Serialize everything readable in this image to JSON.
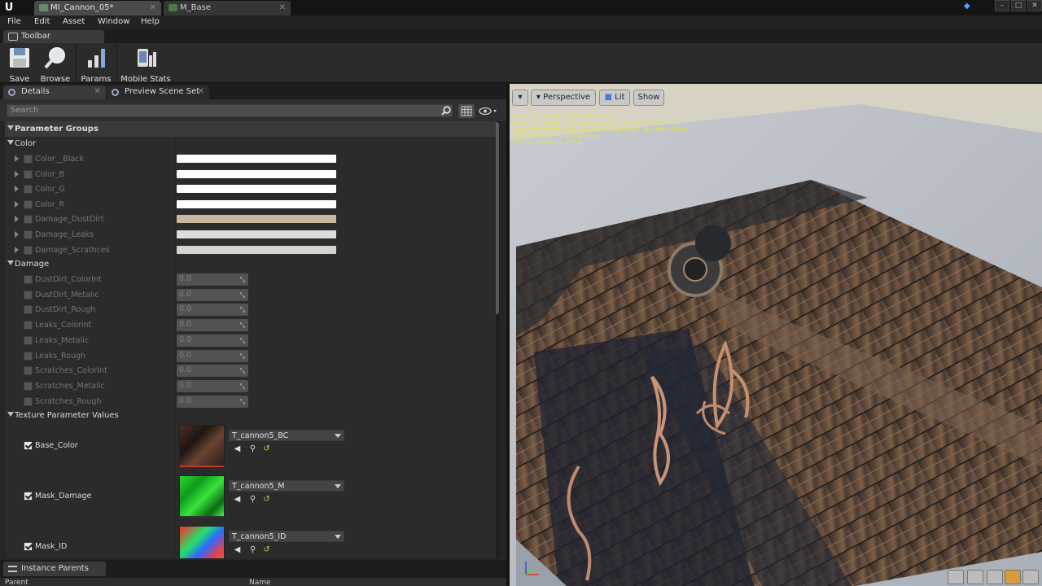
{
  "window": {
    "doc_tabs": [
      "MI_Cannon_05*",
      "M_Base"
    ],
    "controls": [
      "–",
      "□",
      "✕"
    ]
  },
  "menu": [
    "File",
    "Edit",
    "Asset",
    "Window",
    "Help"
  ],
  "toolbar": {
    "tab_label": "Toolbar",
    "buttons": [
      "Save",
      "Browse",
      "Params",
      "Mobile Stats"
    ]
  },
  "details": {
    "tabs": [
      "Details",
      "Preview Scene Set"
    ],
    "search_placeholder": "Search",
    "parameter_groups_label": "Parameter Groups",
    "color_group": {
      "label": "Color",
      "items": [
        {
          "name": "Color__Black",
          "color": "#ffffff"
        },
        {
          "name": "Color_B",
          "color": "#ffffff"
        },
        {
          "name": "Color_G",
          "color": "#ffffff"
        },
        {
          "name": "Color_R",
          "color": "#ffffff"
        },
        {
          "name": "Damage_DustDirt",
          "color": "#c9b8a0"
        },
        {
          "name": "Damage_Leaks",
          "color": "#dedcd9"
        },
        {
          "name": "Damage_Scrathces",
          "color": "#d6d2ce"
        }
      ]
    },
    "damage_group": {
      "label": "Damage",
      "items": [
        {
          "name": "DustDirt_ColorInt",
          "value": "0.0"
        },
        {
          "name": "DustDirt_Metalic",
          "value": "0.0"
        },
        {
          "name": "DustDirt_Rough",
          "value": "0.0"
        },
        {
          "name": "Leaks_ColorInt",
          "value": "0.0"
        },
        {
          "name": "Leaks_Metalic",
          "value": "0.0"
        },
        {
          "name": "Leaks_Rough",
          "value": "0.0"
        },
        {
          "name": "Scratches_ColorInt",
          "value": "0.0"
        },
        {
          "name": "Scratches_Metalic",
          "value": "0.0"
        },
        {
          "name": "Scratches_Rough",
          "value": "0.0"
        }
      ]
    },
    "texture_group": {
      "label": "Texture Parameter Values",
      "items": [
        {
          "name": "Base_Color",
          "texture": "T_cannon5_BC",
          "checked": true
        },
        {
          "name": "Mask_Damage",
          "texture": "T_cannon5_M",
          "checked": true
        },
        {
          "name": "Mask_ID",
          "texture": "T_cannon5_ID",
          "checked": true
        }
      ]
    }
  },
  "instance_parents": {
    "tab_label": "Instance Parents",
    "columns": [
      "Parent",
      "Name"
    ]
  },
  "viewport": {
    "dropdown": "▾",
    "view_mode": "Perspective",
    "lit": "Lit",
    "show": "Show",
    "stats": [
      "Base pass shader: 190 instructions",
      "Base pass shader with Surface Lightmap: 207 instructions",
      "Base pass shader with Volumetric Lightmap: 264 instructions",
      "Vertex shader: 31 instructions",
      "Texture samplers: 10/16"
    ]
  },
  "icons": [
    "unreal-logo-icon",
    "save-icon",
    "browse-icon",
    "params-icon",
    "mobile-stats-icon",
    "search-icon",
    "eye-icon",
    "grid-icon",
    "arrow-left-icon",
    "magnifier-icon",
    "reset-icon",
    "lit-sphere-icon",
    "axis-gizmo-icon"
  ]
}
